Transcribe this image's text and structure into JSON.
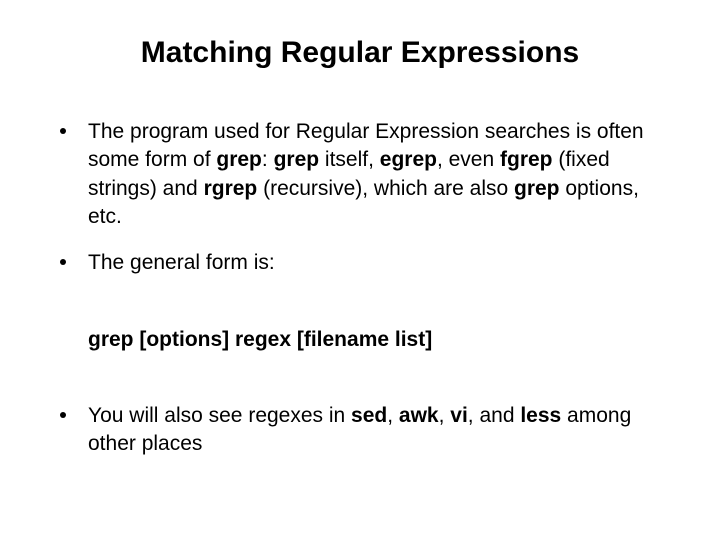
{
  "title": "Matching Regular Expressions",
  "items": {
    "p1": {
      "a": "The program used for Regular Expression searches is often some form of ",
      "b": "grep",
      "c": ": ",
      "d": "grep",
      "e": " itself, ",
      "f": "egrep",
      "g": ", even ",
      "h": "fgrep",
      "i": " (fixed strings) and ",
      "j": "rgrep",
      "k": " (recursive), which are also ",
      "l": "grep",
      "m": " options, etc."
    },
    "p2": "The general form is:",
    "p3": "grep [options] regex [filename list]",
    "p4": {
      "a": "You will also see regexes in ",
      "b": "sed",
      "c": ", ",
      "d": "awk",
      "e": ", ",
      "f": "vi",
      "g": ", and ",
      "h": "less",
      "i": " among other places"
    }
  }
}
